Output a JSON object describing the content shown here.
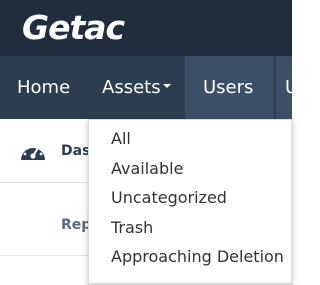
{
  "brand": {
    "logo_text": "Getac"
  },
  "nav": {
    "home": "Home",
    "assets": "Assets",
    "users": "Users",
    "next_partial": "U"
  },
  "content": {
    "dashboard_label": "Das",
    "reports_label": "Rep"
  },
  "assets_menu": {
    "items": [
      {
        "label": "All"
      },
      {
        "label": "Available"
      },
      {
        "label": "Uncategorized"
      },
      {
        "label": "Trash"
      },
      {
        "label": "Approaching Deletion"
      }
    ]
  },
  "colors": {
    "topbar": "#1f2d3d",
    "navbar": "#2c3e50",
    "nav_active": "#3b4f66"
  }
}
